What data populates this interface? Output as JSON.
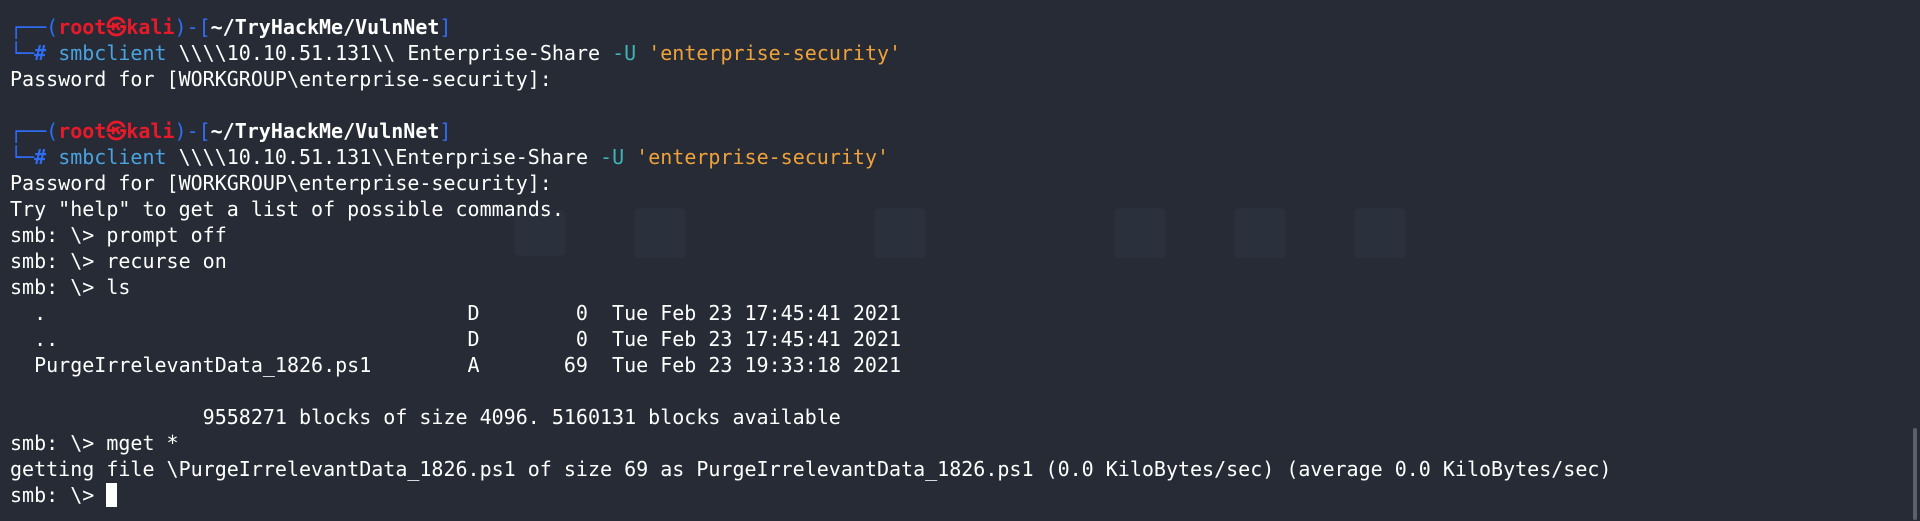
{
  "prompt": {
    "corner_top": "┌──(",
    "user": "root",
    "skull": "㉿",
    "host": "kali",
    "mid": ")-[",
    "path": "~/TryHackMe/VulnNet",
    "close": "]",
    "corner_bottom": "└─",
    "hash": "#"
  },
  "blocks": [
    {
      "cmd": "smbclient",
      "arg1": " \\\\\\\\10.10.51.131\\\\ Enterprise-Share ",
      "flag": "-U",
      "str": " 'enterprise-security'",
      "output": [
        "Password for [WORKGROUP\\enterprise-security]:",
        ""
      ]
    },
    {
      "cmd": "smbclient",
      "arg1": " \\\\\\\\10.10.51.131\\\\Enterprise-Share ",
      "flag": "-U",
      "str": " 'enterprise-security'",
      "output": [
        "Password for [WORKGROUP\\enterprise-security]:",
        "Try \"help\" to get a list of possible commands.",
        "smb: \\> prompt off",
        "smb: \\> recurse on",
        "smb: \\> ls",
        "  .                                   D        0  Tue Feb 23 17:45:41 2021",
        "  ..                                  D        0  Tue Feb 23 17:45:41 2021",
        "  PurgeIrrelevantData_1826.ps1        A       69  Tue Feb 23 19:33:18 2021",
        "",
        "                9558271 blocks of size 4096. 5160131 blocks available",
        "smb: \\> mget *",
        "getting file \\PurgeIrrelevantData_1826.ps1 of size 69 as PurgeIrrelevantData_1826.ps1 (0.0 KiloBytes/sec) (average 0.0 KiloBytes/sec)"
      ]
    }
  ],
  "final_prompt": "smb: \\> ",
  "colors": {
    "background": "#262b35",
    "prompt_blue": "#2f6df6",
    "root_red": "#e81a2a",
    "command": "#4aa3e0",
    "flag": "#3fb3b8",
    "string": "#f0a23a"
  }
}
